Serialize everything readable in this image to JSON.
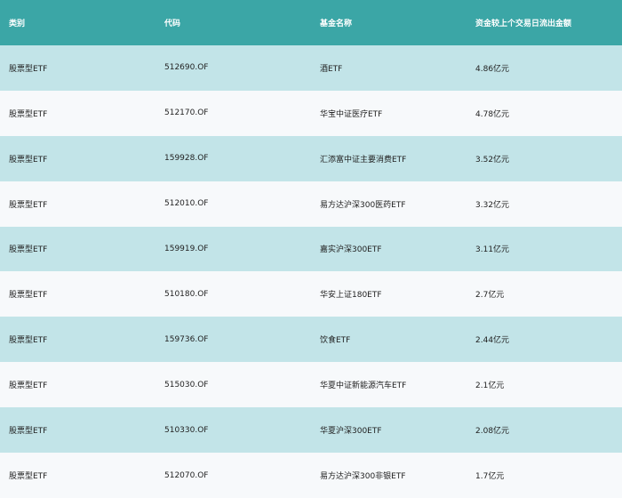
{
  "table": {
    "headers": [
      "类别",
      "代码",
      "基金名称",
      "资金较上个交易日流出金额"
    ],
    "rows": [
      [
        "股票型ETF",
        "512690.OF",
        "酒ETF",
        "4.86亿元"
      ],
      [
        "股票型ETF",
        "512170.OF",
        "华宝中证医疗ETF",
        "4.78亿元"
      ],
      [
        "股票型ETF",
        "159928.OF",
        "汇添富中证主要消费ETF",
        "3.52亿元"
      ],
      [
        "股票型ETF",
        "512010.OF",
        "易方达沪深300医药ETF",
        "3.32亿元"
      ],
      [
        "股票型ETF",
        "159919.OF",
        "嘉实沪深300ETF",
        "3.11亿元"
      ],
      [
        "股票型ETF",
        "510180.OF",
        "华安上证180ETF",
        "2.7亿元"
      ],
      [
        "股票型ETF",
        "159736.OF",
        "饮食ETF",
        "2.44亿元"
      ],
      [
        "股票型ETF",
        "515030.OF",
        "华夏中证新能源汽车ETF",
        "2.1亿元"
      ],
      [
        "股票型ETF",
        "510330.OF",
        "华夏沪深300ETF",
        "2.08亿元"
      ],
      [
        "股票型ETF",
        "512070.OF",
        "易方达沪深300非银ETF",
        "1.7亿元"
      ]
    ]
  },
  "colors": {
    "header_bg": "#3ba6a6",
    "row_odd_bg": "#c2e4e8",
    "row_even_bg": "#f7f9fb"
  }
}
